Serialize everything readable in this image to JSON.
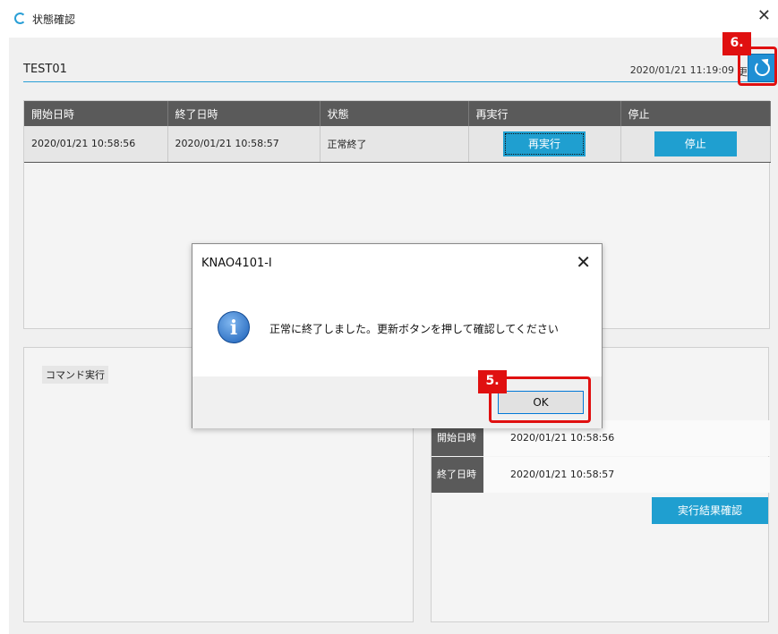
{
  "window": {
    "title": "状態確認",
    "close_glyph": "✕",
    "icon": "refresh-app-icon"
  },
  "header": {
    "job_name": "TEST01",
    "updated_at": "2020/01/21 11:19:09",
    "updated_label": "更新",
    "refresh_icon": "refresh-icon"
  },
  "runs_table": {
    "columns": [
      "開始日時",
      "終了日時",
      "状態",
      "再実行",
      "停止"
    ],
    "rows": [
      {
        "start": "2020/01/21 10:58:56",
        "end": "2020/01/21 10:58:57",
        "status": "正常終了",
        "rerun_label": "再実行",
        "stop_label": "停止"
      }
    ]
  },
  "command_panel": {
    "label": "コマンド実行"
  },
  "details": {
    "rows": [
      {
        "key": "開始日時",
        "value": "2020/01/21 10:58:56"
      },
      {
        "key": "終了日時",
        "value": "2020/01/21 10:58:57"
      }
    ],
    "result_button": "実行結果確認"
  },
  "dialog": {
    "title": "KNAO4101-I",
    "close_glyph": "✕",
    "message": "正常に終了しました。更新ボタンを押して確認してください",
    "ok_label": "OK",
    "icon": "info-icon"
  },
  "callouts": {
    "step5": "5.",
    "step6": "6."
  },
  "colors": {
    "accent": "#1f9fd0",
    "callout": "#e01010",
    "header_bg": "#5a5a5a"
  }
}
